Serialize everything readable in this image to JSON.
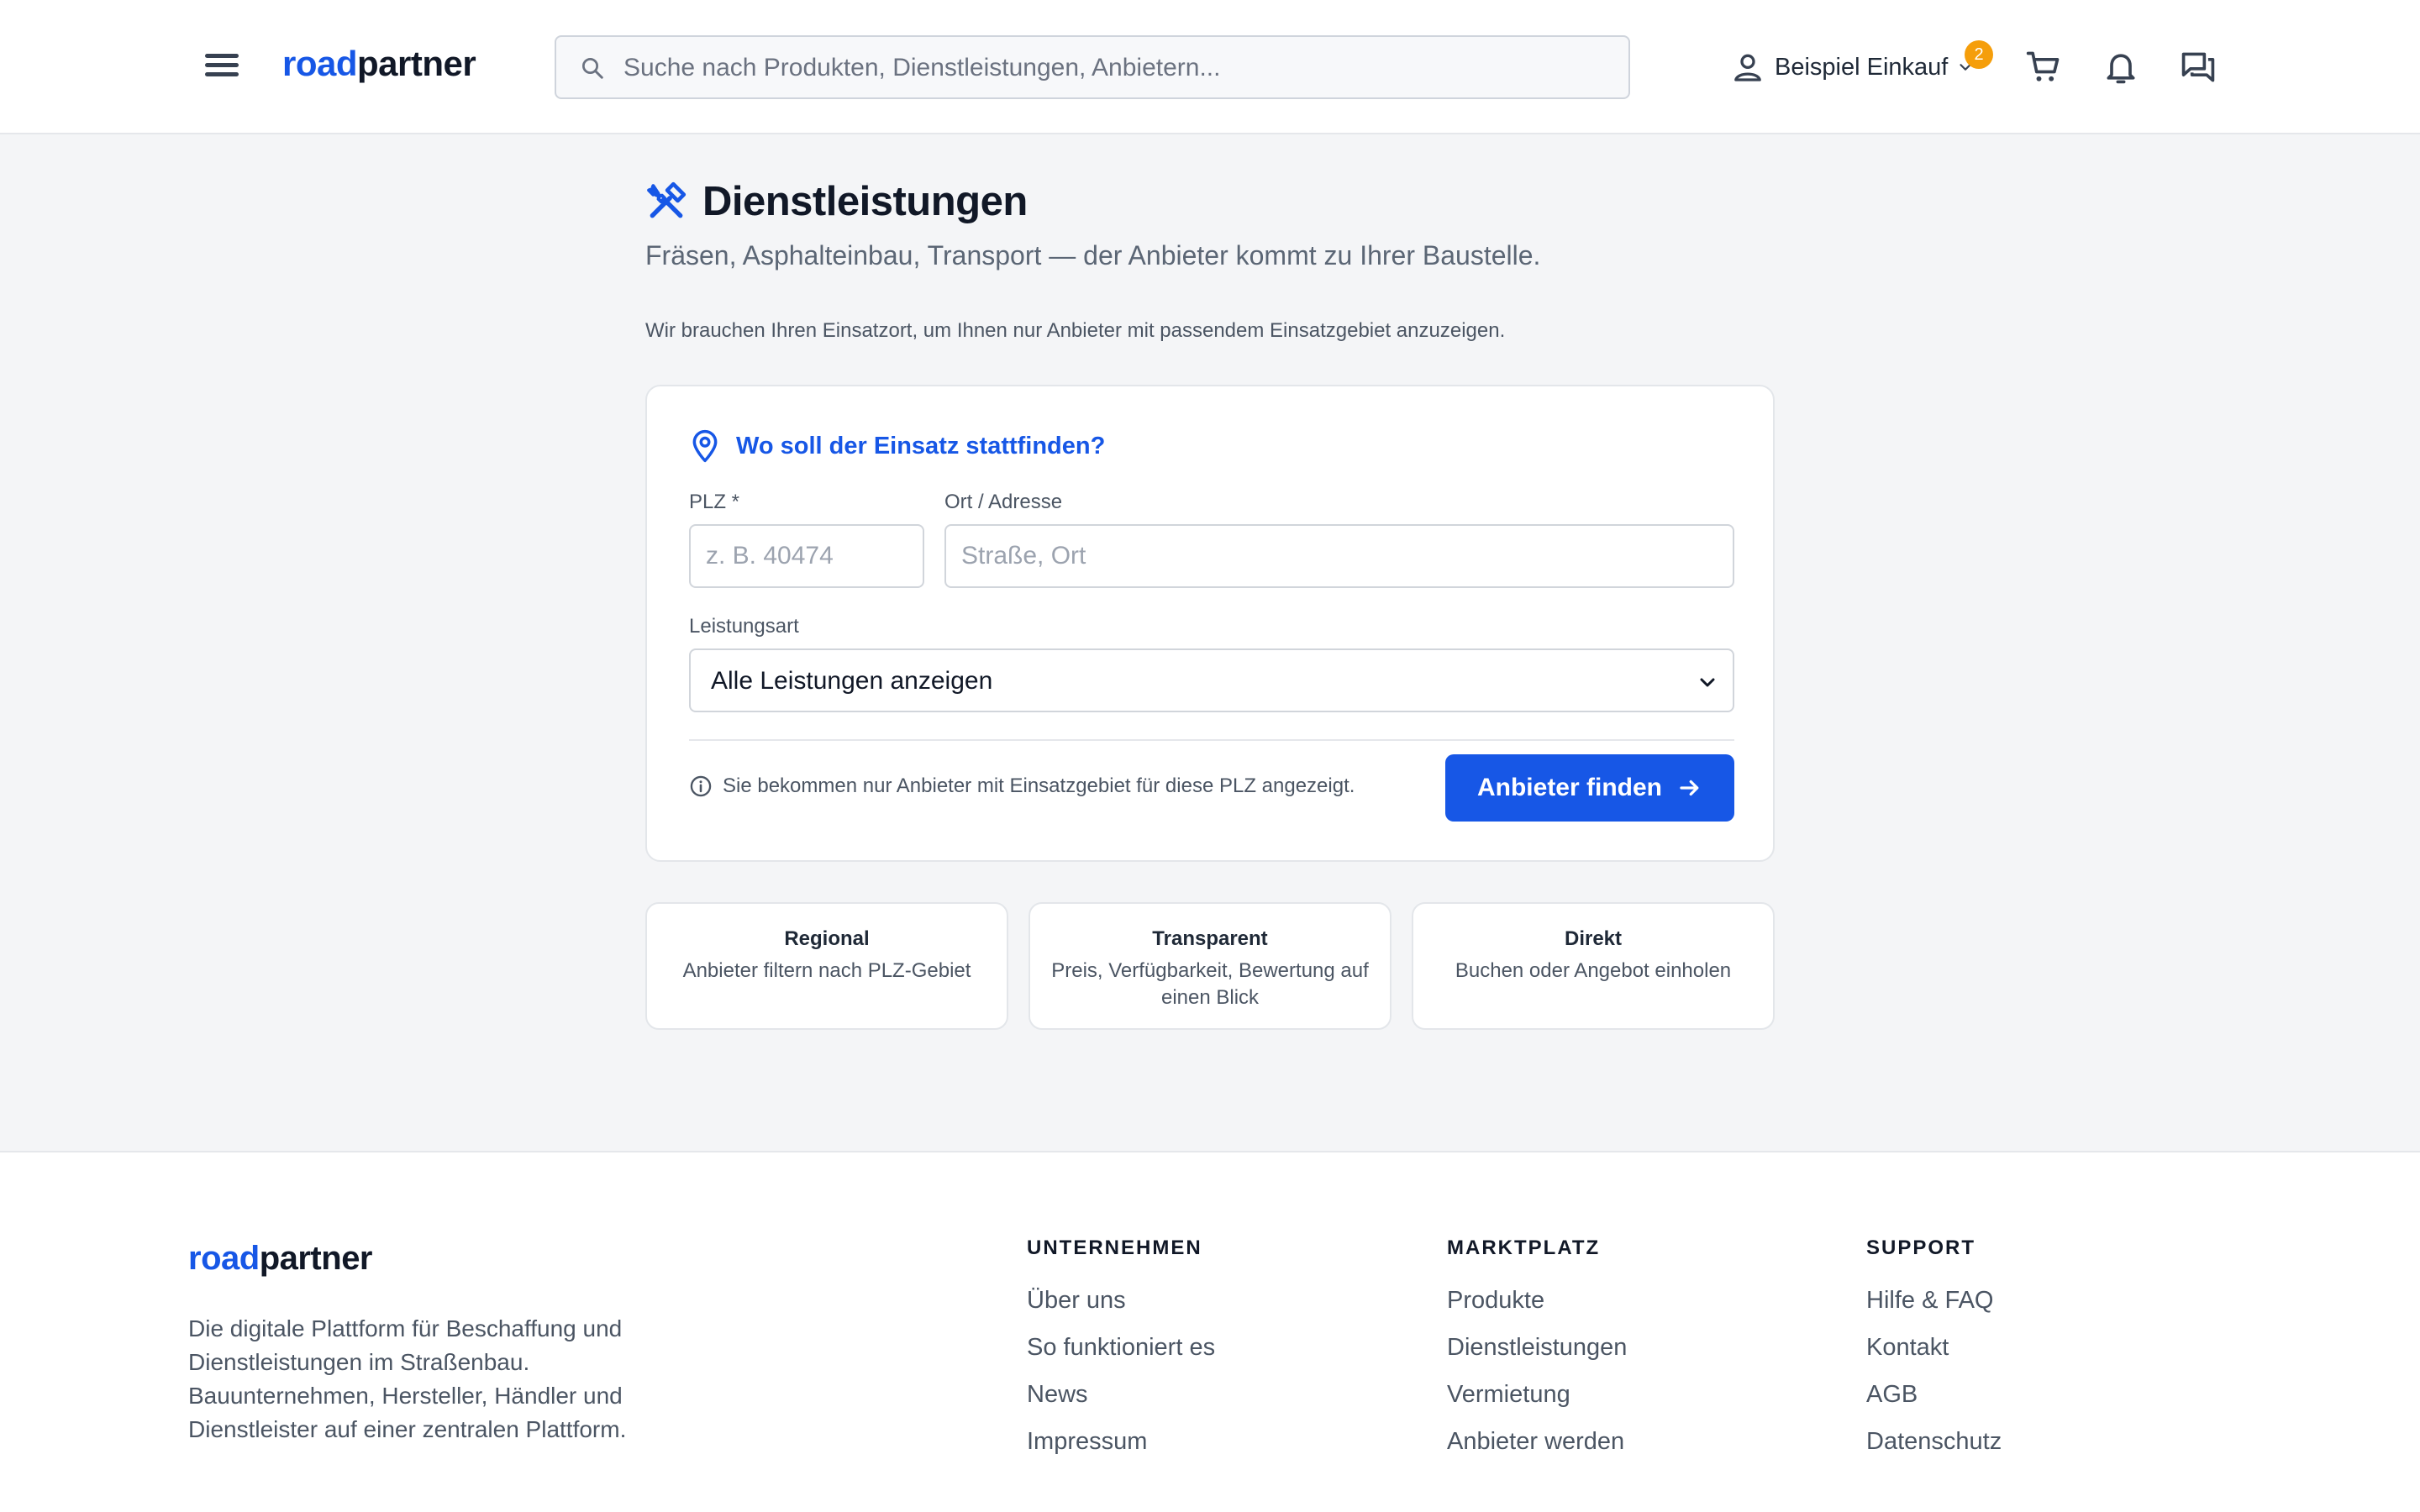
{
  "header": {
    "logo": {
      "accent": "road",
      "rest": "partner"
    },
    "search_placeholder": "Suche nach Produkten, Dienstleistungen, Anbietern...",
    "user_name": "Beispiel Einkauf",
    "badge_count": "2"
  },
  "page": {
    "title": "Dienstleistungen",
    "subtitle": "Fräsen, Asphalteinbau, Transport — der Anbieter kommt zu Ihrer Baustelle.",
    "hint": "Wir brauchen Ihren Einsatzort, um Ihnen nur Anbieter mit passendem Einsatzgebiet anzuzeigen."
  },
  "form": {
    "heading": "Wo soll der Einsatz stattfinden?",
    "plz_label": "PLZ *",
    "plz_placeholder": "z. B. 40474",
    "ort_label": "Ort / Adresse",
    "ort_placeholder": "Straße, Ort",
    "service_label": "Leistungsart",
    "service_selected": "Alle Leistungen anzeigen",
    "note": "Sie bekommen nur Anbieter mit Einsatzgebiet für diese PLZ angezeigt.",
    "submit": "Anbieter finden"
  },
  "features": [
    {
      "title": "Regional",
      "desc": "Anbieter filtern nach PLZ-Gebiet"
    },
    {
      "title": "Transparent",
      "desc": "Preis, Verfügbarkeit, Bewertung auf einen Blick"
    },
    {
      "title": "Direkt",
      "desc": "Buchen oder Angebot einholen"
    }
  ],
  "footer": {
    "logo": {
      "accent": "road",
      "rest": "partner"
    },
    "description": "Die digitale Plattform für Beschaffung und Dienstleistungen im Straßenbau. Bauunternehmen, Hersteller, Händler und Dienstleister auf einer zentralen Plattform.",
    "columns": [
      {
        "heading": "UNTERNEHMEN",
        "links": [
          "Über uns",
          "So funktioniert es",
          "News",
          "Impressum"
        ]
      },
      {
        "heading": "MARKTPLATZ",
        "links": [
          "Produkte",
          "Dienstleistungen",
          "Vermietung",
          "Anbieter werden"
        ]
      },
      {
        "heading": "SUPPORT",
        "links": [
          "Hilfe & FAQ",
          "Kontakt",
          "AGB",
          "Datenschutz"
        ]
      }
    ]
  },
  "colors": {
    "brand": "#1757e6",
    "badge": "#f59e0b",
    "background": "#f4f5f7"
  },
  "icons": [
    "menu-icon",
    "search-icon",
    "user-icon",
    "chevron-down-icon",
    "cart-icon",
    "bell-icon",
    "chat-icon",
    "tools-icon",
    "location-pin-icon",
    "info-icon",
    "arrow-right-icon"
  ]
}
